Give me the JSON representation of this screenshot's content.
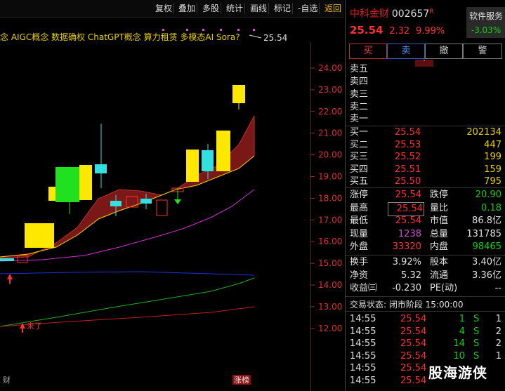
{
  "toolbar": {
    "buttons": [
      "复权",
      "叠加",
      "多股",
      "统计",
      "画线",
      "标记",
      "-自选"
    ],
    "back": "返回"
  },
  "chart": {
    "concepts": "念 AIGC概念 数据确权 ChatGPT概念 算力租赁 多模态AI Sora?",
    "last_price_label": "25.54",
    "y_ticks": [
      "24.00",
      "23.00",
      "22.00",
      "21.00",
      "20.00",
      "19.00",
      "18.00",
      "17.00",
      "16.00",
      "15.00",
      "14.00",
      "13.00",
      "12.00"
    ],
    "annotation_buy": "来了",
    "bottom_left": "财",
    "bottom_tag": "涨榜"
  },
  "panel": {
    "name": "中科金财",
    "code": "002657",
    "r_mark": "R",
    "service_label": "软件服务",
    "service_change": "-3.03%",
    "price": "25.54",
    "change": "2.32",
    "change_pct": "9.99%",
    "buttons": [
      "买",
      "卖",
      "撤",
      "警"
    ],
    "asks": [
      "卖五",
      "卖四",
      "卖三",
      "卖二",
      "卖一"
    ],
    "bids": [
      {
        "label": "买一",
        "price": "25.54",
        "vol": "202134"
      },
      {
        "label": "买二",
        "price": "25.53",
        "vol": "447"
      },
      {
        "label": "买三",
        "price": "25.52",
        "vol": "199"
      },
      {
        "label": "买四",
        "price": "25.51",
        "vol": "159"
      },
      {
        "label": "买五",
        "price": "25.50",
        "vol": "795"
      }
    ],
    "stats": [
      {
        "l1": "涨停",
        "v1": "25.54",
        "l2": "跌停",
        "v2": "20.90"
      },
      {
        "l1": "最高",
        "v1": "25.54",
        "l2": "量比",
        "v2": "0.18"
      },
      {
        "l1": "最低",
        "v1": "25.54",
        "l2": "市值",
        "v2": "86.8亿"
      },
      {
        "l1": "现量",
        "v1": "1238",
        "l2": "总量",
        "v2": "131785"
      },
      {
        "l1": "外盘",
        "v1": "33320",
        "l2": "内盘",
        "v2": "98465"
      }
    ],
    "stats2": [
      {
        "l1": "换手",
        "v1": "3.92%",
        "l2": "股本",
        "v2": "3.40亿"
      },
      {
        "l1": "净资",
        "v1": "5.32",
        "l2": "流通",
        "v2": "3.36亿"
      },
      {
        "l1": "收益㈢",
        "v1": "-0.230",
        "l2": "PE(动)",
        "v2": "--"
      }
    ],
    "trade_status": "交易状态: 闭市阶段 15:00:00",
    "ticks": [
      {
        "t": "14:55",
        "p": "25.54",
        "v": "1",
        "s": "S",
        "n": "1"
      },
      {
        "t": "14:55",
        "p": "25.54",
        "v": "4",
        "s": "S",
        "n": "2"
      },
      {
        "t": "14:55",
        "p": "25.54",
        "v": "14",
        "s": "S",
        "n": "2"
      },
      {
        "t": "14:55",
        "p": "25.54",
        "v": "10",
        "s": "S",
        "n": "1"
      },
      {
        "t": "14:55",
        "p": "25.54",
        "v": "",
        "s": "",
        "n": ""
      },
      {
        "t": "14:55",
        "p": "25.54",
        "v": "",
        "s": "",
        "n": ""
      }
    ]
  },
  "watermark": "股海游侠"
}
